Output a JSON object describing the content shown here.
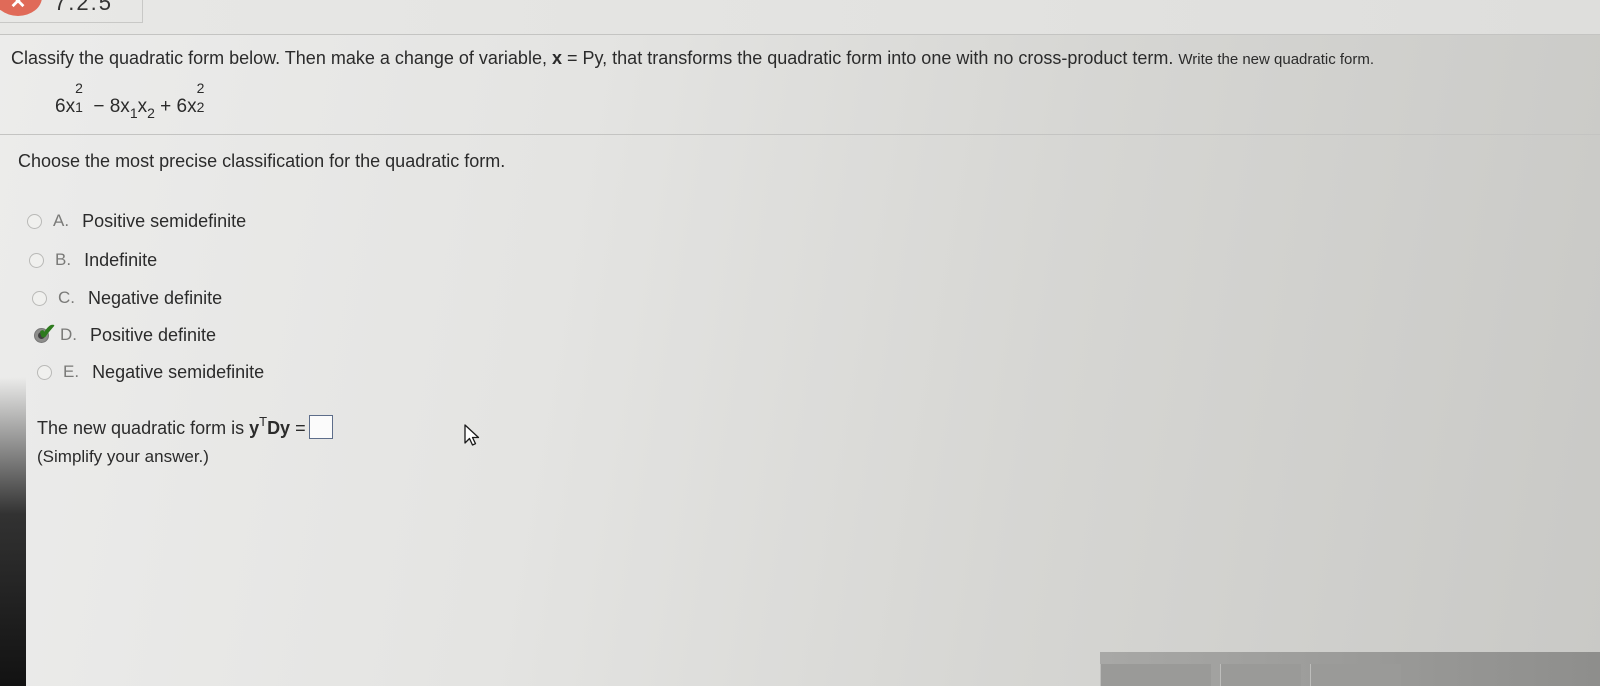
{
  "header": {
    "status_icon": "x-mark-icon",
    "status_symbol": "✕",
    "problem_number": "7.2.5",
    "status_color": "#e06a58"
  },
  "instructions": {
    "part1": "Classify the quadratic form below. Then make a change of variable, ",
    "var": "x",
    "eq": " = ",
    "py": "Py",
    "part2": ", that transforms the quadratic form into one with no cross-product term. ",
    "part3": "Write the new quadratic form."
  },
  "equation": {
    "t1_coef": "6x",
    "t1_sup": "2",
    "t1_sub": "1",
    "op1": " − 8x",
    "t2_sub1": "1",
    "t2_x": "x",
    "t2_sub2": "2",
    "op2": " + 6x",
    "t3_sup": "2",
    "t3_sub": "2"
  },
  "question": "Choose the most precise classification for the quadratic form.",
  "options": [
    {
      "letter": "A.",
      "label": "Positive semidefinite",
      "selected": false
    },
    {
      "letter": "B.",
      "label": "Indefinite",
      "selected": false
    },
    {
      "letter": "C.",
      "label": "Negative definite",
      "selected": false
    },
    {
      "letter": "D.",
      "label": "Positive definite",
      "selected": true,
      "correct": true
    },
    {
      "letter": "E.",
      "label": "Negative semidefinite",
      "selected": false
    }
  ],
  "answer": {
    "prefix": "The new quadratic form is ",
    "y": "y",
    "T": "T",
    "Dy": "Dy",
    "eq": " =",
    "input_value": "",
    "hint": "(Simplify your answer.)"
  },
  "colors": {
    "checkmark": "#2d7a1e",
    "answer_box_border": "#5d6d8a"
  }
}
